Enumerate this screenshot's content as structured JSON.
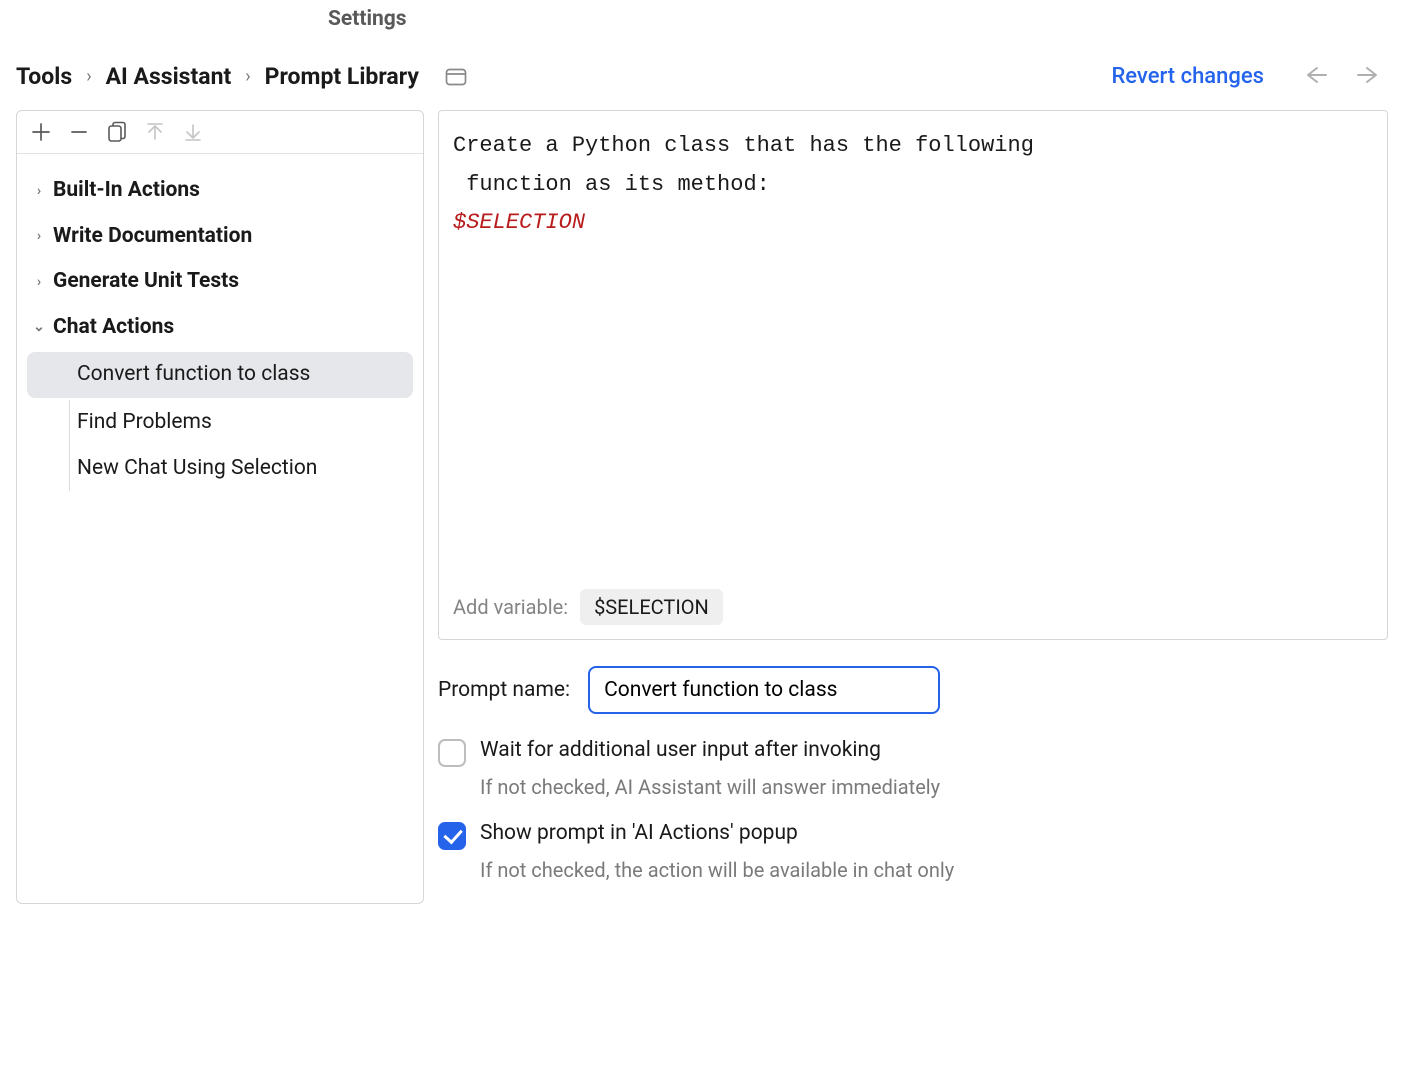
{
  "header": {
    "title": "Settings",
    "breadcrumb": [
      "Tools",
      "AI Assistant",
      "Prompt Library"
    ],
    "revert_label": "Revert changes"
  },
  "toolbar": {
    "add": "plus-icon",
    "remove": "minus-icon",
    "copy": "copy-icon",
    "up": "arrow-up-icon",
    "down": "arrow-down-icon"
  },
  "tree": {
    "items": [
      {
        "label": "Built-In Actions",
        "expanded": false
      },
      {
        "label": "Write Documentation",
        "expanded": false
      },
      {
        "label": "Generate Unit Tests",
        "expanded": false
      },
      {
        "label": "Chat Actions",
        "expanded": true
      }
    ],
    "chat_actions": [
      {
        "label": "Convert function to class",
        "selected": true
      },
      {
        "label": "Find Problems",
        "selected": false
      },
      {
        "label": "New Chat Using Selection",
        "selected": false
      }
    ]
  },
  "editor": {
    "line1": "Create a Python class that has the following",
    "line2": " function as its method:",
    "variable_token": "$SELECTION",
    "add_variable_label": "Add variable:",
    "variable_chip": "$SELECTION"
  },
  "form": {
    "prompt_name_label": "Prompt name:",
    "prompt_name_value": "Convert function to class",
    "wait_input_label": "Wait for additional user input after invoking",
    "wait_input_desc": "If not checked, AI Assistant will answer immediately",
    "wait_input_checked": false,
    "show_popup_label": "Show prompt in 'AI Actions' popup",
    "show_popup_desc": "If not checked, the action will be available in chat only",
    "show_popup_checked": true
  }
}
